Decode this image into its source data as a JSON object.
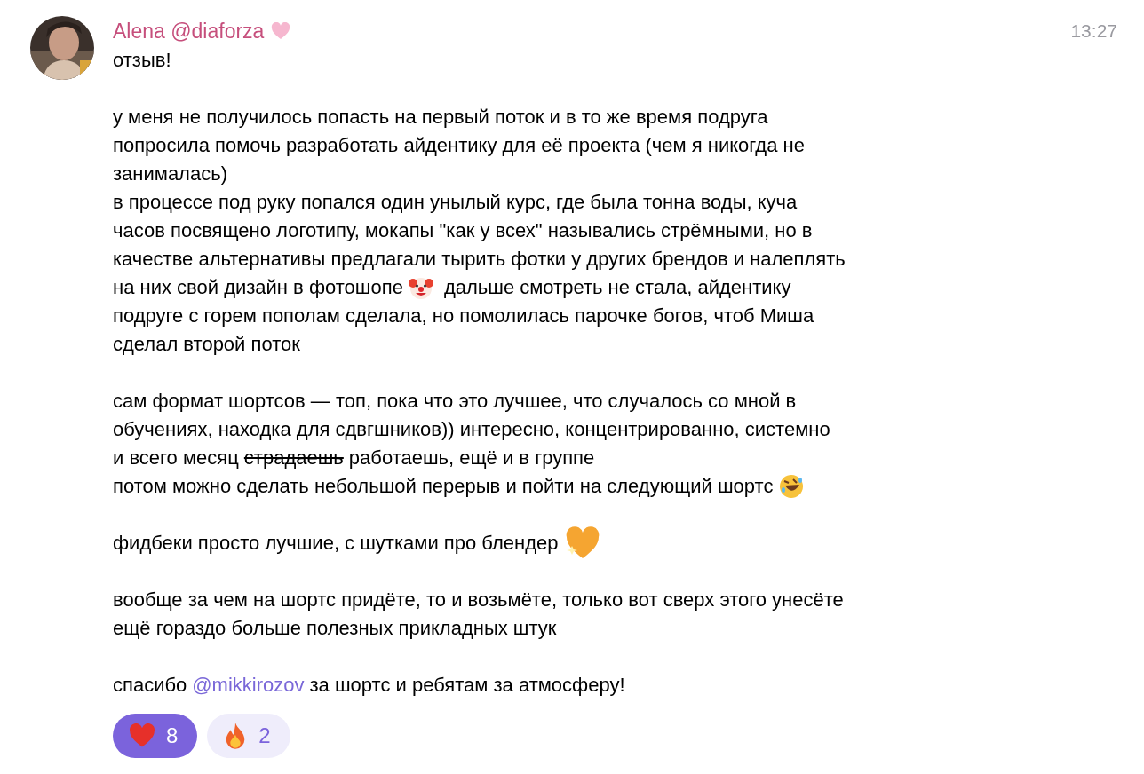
{
  "message": {
    "author": "Alena @diaforza",
    "time": "13:27",
    "paragraphs": [
      {
        "lines": [
          [
            {
              "kind": "text",
              "text": "отзыв!"
            }
          ]
        ]
      },
      {
        "lines": [
          [
            {
              "kind": "text",
              "text": "у меня не получилось попасть на первый поток и в то же время подруга"
            }
          ],
          [
            {
              "kind": "text",
              "text": "попросила помочь разработать айдентику для её проекта (чем я никогда не"
            }
          ],
          [
            {
              "kind": "text",
              "text": "занималась)"
            }
          ],
          [
            {
              "kind": "text",
              "text": "в процессе под руку попался один унылый курс, где была тонна воды, куча"
            }
          ],
          [
            {
              "kind": "text",
              "text": "часов посвящено логотипу, мокапы \"как у всех\" назывались стрёмными, но в"
            }
          ],
          [
            {
              "kind": "text",
              "text": "качестве альтернативы предлагали тырить фотки у других брендов и налеплять"
            }
          ],
          [
            {
              "kind": "text",
              "text": "на них свой дизайн в фотошопе"
            },
            {
              "kind": "emoji"
            },
            {
              "kind": "text",
              "text": "дальше смотреть не стала, айдентику"
            }
          ],
          [
            {
              "kind": "text",
              "text": "подруге с горем пополам сделала, но помолилась парочке богов, чтоб Миша"
            }
          ],
          [
            {
              "kind": "text",
              "text": "сделал второй поток"
            }
          ]
        ]
      },
      {
        "lines": [
          [
            {
              "kind": "text",
              "text": "сам формат шортсов — топ, пока что это лучшее, что случалось со мной в"
            }
          ],
          [
            {
              "kind": "text",
              "text": "обучениях, находка для сдвгшников)) интересно, концентрированно, системно"
            }
          ],
          [
            {
              "kind": "text",
              "text": "и всего месяц"
            },
            {
              "kind": "strike",
              "text": "страдаешь"
            },
            {
              "kind": "text",
              "text": "работаешь, ещё и в группе"
            }
          ],
          [
            {
              "kind": "text",
              "text": "потом можно сделать небольшой перерыв и пойти на следующий шортс"
            },
            {
              "kind": "emoji"
            }
          ]
        ]
      },
      {
        "lines": [
          [
            {
              "kind": "text",
              "text": "фидбеки просто лучшие, с шутками про блендер"
            },
            {
              "kind": "emoji"
            }
          ]
        ]
      },
      {
        "lines": [
          [
            {
              "kind": "text",
              "text": "вообще за чем на шортс придёте, то и возьмёте, только вот сверх этого унесёте"
            }
          ],
          [
            {
              "kind": "text",
              "text": "ещё гораздо больше полезных прикладных штук"
            }
          ]
        ]
      },
      {
        "lines": [
          [
            {
              "kind": "text",
              "text": "спасибо"
            },
            {
              "kind": "mention",
              "text": "@mikkirozov"
            },
            {
              "kind": "text",
              "text": "за шортс и ребятам за атмосферу!"
            }
          ]
        ]
      }
    ],
    "reactions": [
      {
        "count": "8",
        "selected": true
      },
      {
        "count": "2",
        "selected": false
      }
    ]
  }
}
